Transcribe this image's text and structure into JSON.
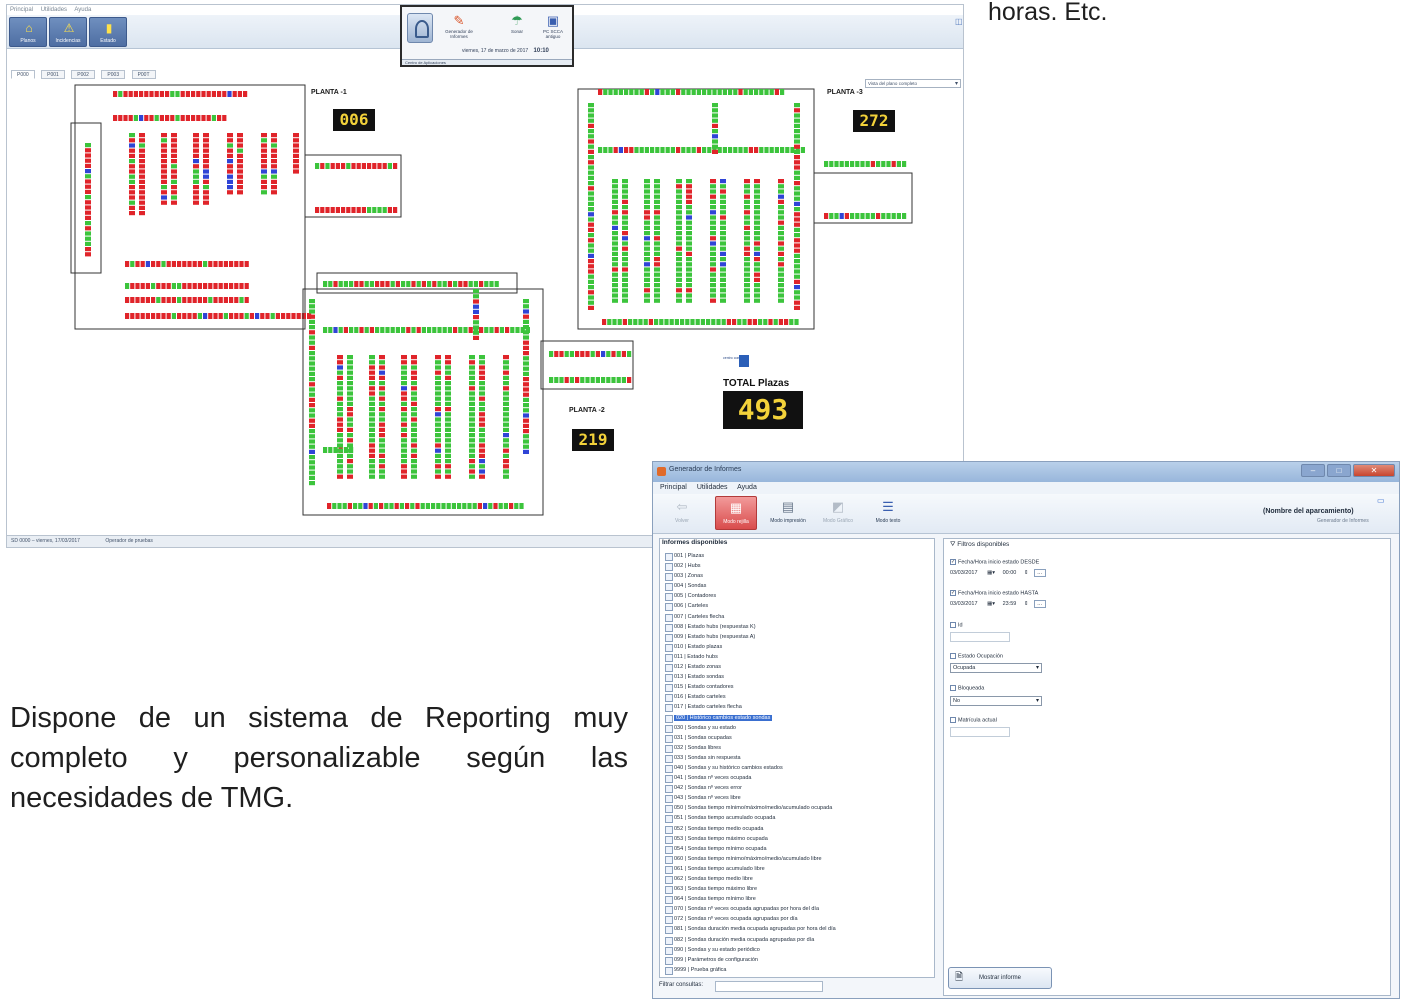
{
  "slide": {
    "top_text": "horas. Etc.",
    "paragraph": "Dispone de un sistema de Reporting muy completo y personalizable según las necesidades de TMG."
  },
  "app1": {
    "menu": [
      "Principal",
      "Utilidades",
      "Ayuda"
    ],
    "ribbon_buttons": [
      {
        "label": "Planos",
        "icon": "map-icon"
      },
      {
        "label": "Incidencias",
        "icon": "warning-icon"
      },
      {
        "label": "Estado",
        "icon": "status-icon"
      }
    ],
    "popup": {
      "items": [
        {
          "label": "Generador de Informes",
          "icon": "report-icon"
        },
        {
          "label": "Sonar",
          "icon": "sonar-icon"
        },
        {
          "label": "PC SCCA antiguo",
          "icon": "pc-icon"
        }
      ],
      "date": "viernes, 17 de marzo de 2017",
      "time": "10:10",
      "footer": "Centro de Aplicaciones"
    },
    "tabs": [
      "P000",
      "P001",
      "P002",
      "P003",
      "P00T"
    ],
    "view_select": "Vista del plano completo",
    "floors": [
      {
        "label": "PLANTA -1",
        "count": "006"
      },
      {
        "label": "PLANTA -3",
        "count": "272"
      },
      {
        "label": "PLANTA -2",
        "count": "219"
      }
    ],
    "brand_text": "centro comercial",
    "total_label": "TOTAL Plazas",
    "total_count": "493",
    "status": [
      "SD 0000 – viernes, 17/03/2017",
      "Operador de pruebas"
    ],
    "colors": {
      "occupied": "#e0242a",
      "free": "#3cc43c",
      "special": "#2f44d6",
      "wall": "#333333"
    }
  },
  "app2": {
    "title": "Generador de Informes",
    "menu": [
      "Principal",
      "Utilidades",
      "Ayuda"
    ],
    "ribbon": [
      {
        "label": "Volver",
        "icon": "back-icon",
        "state": "disabled"
      },
      {
        "label": "Modo rejilla",
        "icon": "grid-icon",
        "state": "active"
      },
      {
        "label": "Modo impresión",
        "icon": "print-icon",
        "state": "normal"
      },
      {
        "label": "Modo Gráfico",
        "icon": "chart-icon",
        "state": "disabled"
      },
      {
        "label": "Modo texto",
        "icon": "text-icon",
        "state": "normal"
      }
    ],
    "park_name": "(Nombre del aparcamiento)",
    "park_sub": "Generador de Informes",
    "list_header": "Informes disponibles",
    "reports": [
      "001 | Plazas",
      "002 | Hubs",
      "003 | Zonas",
      "004 | Sondas",
      "005 | Contadores",
      "006 | Carteles",
      "007 | Carteles flecha",
      "008 | Estado hubs (respuestas K)",
      "009 | Estado hubs (respuestas A)",
      "010 | Estado plazas",
      "011 | Estado hubs",
      "012 | Estado zonas",
      "013 | Estado sondas",
      "015 | Estado contadores",
      "016 | Estado carteles",
      "017 | Estado carteles flecha",
      "020 | Histórico cambios estado sondas",
      "030 | Sondas y su estado",
      "031 | Sondas ocupadas",
      "032 | Sondas libres",
      "033 | Sondas sin respuesta",
      "040 | Sondas y su histórico cambios estados",
      "041 | Sondas nº veces ocupada",
      "042 | Sondas nº veces error",
      "043 | Sondas nº veces libre",
      "050 | Sondas tiempo mínimo/máximo/medio/acumulado ocupada",
      "051 | Sondas tiempo acumulado ocupada",
      "052 | Sondas tiempo medio ocupada",
      "053 | Sondas tiempo máximo ocupada",
      "054 | Sondas tiempo mínimo ocupada",
      "060 | Sondas tiempo mínimo/máximo/medio/acumulado libre",
      "061 | Sondas tiempo acumulado libre",
      "062 | Sondas tiempo medio libre",
      "063 | Sondas tiempo máximo libre",
      "064 | Sondas tiempo mínimo libre",
      "070 | Sondas nº veces ocupada agrupadas por hora del día",
      "072 | Sondas nº veces ocupada agrupadas por día",
      "081 | Sondas duración media ocupada agrupadas por hora del día",
      "082 | Sondas duración media ocupada agrupadas por día",
      "090 | Sondas y su estado periódico",
      "099 | Parámetros de configuración",
      "9999 | Prueba gráfica"
    ],
    "selected_index": 16,
    "filter_label": "Filtrar consultas:",
    "filters": {
      "header": "Filtros disponibles",
      "from_label": "Fecha/Hora inicio estado DESDE",
      "from_date": "03/03/2017",
      "from_time": "00:00",
      "to_label": "Fecha/Hora inicio estado HASTA",
      "to_date": "03/03/2017",
      "to_time": "23:59",
      "id_label": "Id",
      "occ_label": "Estado Ocupación",
      "occ_value": "Ocupada",
      "block_label": "Bloqueada",
      "block_value": "No",
      "plate_label": "Matrícula actual",
      "show_button": "Mostrar informe"
    }
  }
}
